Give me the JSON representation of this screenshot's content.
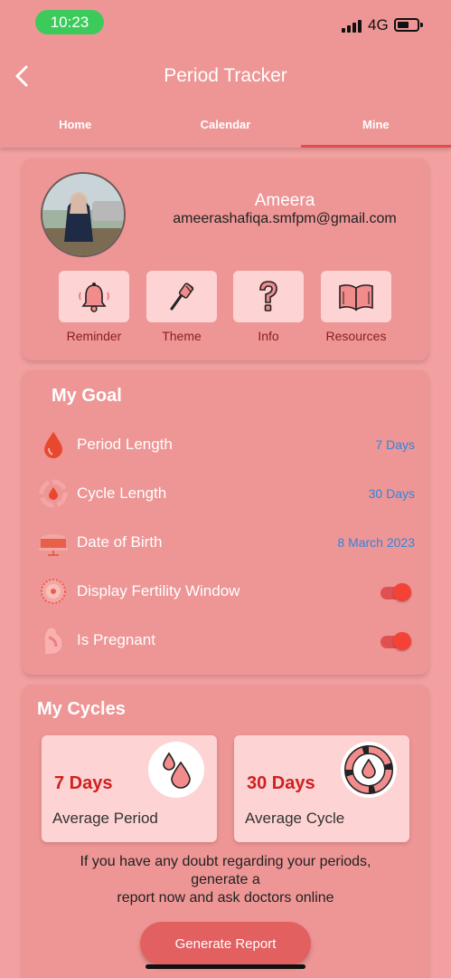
{
  "status": {
    "time": "10:23",
    "network": "4G"
  },
  "header": {
    "title": "Period Tracker"
  },
  "tabs": [
    {
      "label": "Home",
      "active": false
    },
    {
      "label": "Calendar",
      "active": false
    },
    {
      "label": "Mine",
      "active": true
    }
  ],
  "profile": {
    "name": "Ameera",
    "email": "ameerashafiqa.smfpm@gmail.com",
    "actions": [
      {
        "label": "Reminder",
        "icon": "bell-icon"
      },
      {
        "label": "Theme",
        "icon": "paintbrush-icon"
      },
      {
        "label": "Info",
        "icon": "question-icon"
      },
      {
        "label": "Resources",
        "icon": "book-icon"
      }
    ]
  },
  "goal": {
    "title": "My Goal",
    "rows": [
      {
        "label": "Period Length",
        "value": "7 Days",
        "icon": "blood-drop-icon"
      },
      {
        "label": "Cycle Length",
        "value": "30 Days",
        "icon": "cycle-icon"
      },
      {
        "label": "Date of Birth",
        "value": "8 March 2023",
        "icon": "cake-icon"
      },
      {
        "label": "Display Fertility Window",
        "toggle": true,
        "icon": "fertility-icon"
      },
      {
        "label": "Is Pregnant",
        "toggle": true,
        "icon": "pregnant-icon"
      }
    ]
  },
  "cycles": {
    "title": "My Cycles",
    "period": {
      "value": "7 Days",
      "label": "Average Period"
    },
    "cycle": {
      "value": "30 Days",
      "label": "Average Cycle"
    },
    "note_line1": "If you have any doubt regarding your periods,",
    "note_line2": "generate a",
    "note_line3": "report now and ask doctors online",
    "button": "Generate Report"
  },
  "colors": {
    "primary": "#EE9595",
    "accent": "#E34D4D",
    "value_text": "#2F86E0",
    "card_light": "#FDD3D3"
  }
}
